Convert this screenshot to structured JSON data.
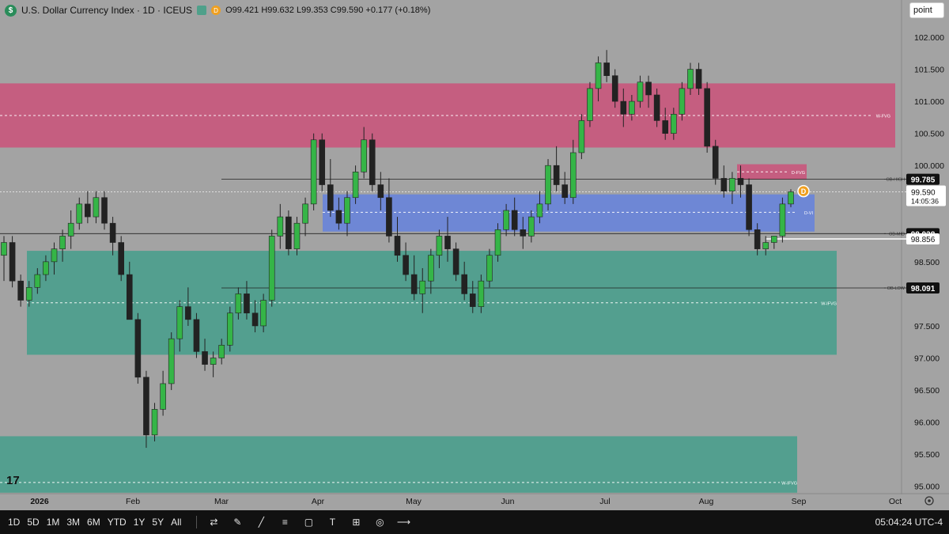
{
  "header": {
    "title": "U.S. Dollar Currency Index · 1D · ICEUS",
    "ohlc": "O99.421 H99.632 L99.353 C99.590 +0.177 (+0.18%)",
    "logo_glyph": "$",
    "badge_letter": "D"
  },
  "point_button": {
    "label": "point"
  },
  "chart_data": {
    "type": "candlestick",
    "ylim": [
      94.85,
      102.4
    ],
    "x_tick_labels": [
      "2026",
      "Feb",
      "Mar",
      "Apr",
      "May",
      "Jun",
      "Jul",
      "Aug",
      "Sep",
      "Oct"
    ],
    "y_ticks": [
      "102.000",
      "101.500",
      "101.000",
      "100.500",
      "100.000",
      "98.500",
      "97.500",
      "97.000",
      "96.500",
      "96.000",
      "95.500",
      "95.000"
    ],
    "zones": [
      {
        "label": "W-FVG",
        "low": 100.28,
        "high": 101.28,
        "mid": 100.78,
        "color": "#c75b7e"
      },
      {
        "label": "D-FVG",
        "low": 99.78,
        "high": 100.02,
        "mid": 99.9,
        "color": "#c75b7e"
      },
      {
        "label": "D-VI",
        "low": 98.97,
        "high": 99.55,
        "mid": 99.27,
        "color": "#6b86d8"
      },
      {
        "label": "W-IFVG",
        "low": 97.05,
        "high": 98.67,
        "mid": 97.86,
        "color": "#4f9f8e"
      },
      {
        "label": "W-IFVG",
        "low": 94.9,
        "high": 95.78,
        "mid": 95.06,
        "color": "#4f9f8e"
      }
    ],
    "levels": [
      {
        "label": "OB-HIGH",
        "value": 99.785,
        "price_text": "99.785"
      },
      {
        "label": "OB-MID",
        "value": 98.938,
        "price_text": "98.938"
      },
      {
        "label": "OB-LOW",
        "value": 98.091,
        "price_text": "98.091"
      }
    ],
    "white_level": {
      "value": 98.856,
      "price_text": "98.856"
    },
    "current": {
      "value": 99.59,
      "price_text": "99.590",
      "countdown": "14:05:36"
    },
    "candles_ohlc": [
      [
        98.6,
        98.9,
        98.2,
        98.8
      ],
      [
        98.8,
        98.9,
        98.1,
        98.2
      ],
      [
        98.2,
        98.3,
        97.8,
        97.9
      ],
      [
        97.9,
        98.2,
        97.8,
        98.1
      ],
      [
        98.1,
        98.4,
        98.0,
        98.3
      ],
      [
        98.3,
        98.6,
        98.2,
        98.5
      ],
      [
        98.5,
        98.8,
        98.3,
        98.7
      ],
      [
        98.7,
        99.0,
        98.5,
        98.9
      ],
      [
        98.9,
        99.3,
        98.7,
        99.1
      ],
      [
        99.1,
        99.5,
        99.0,
        99.4
      ],
      [
        99.4,
        99.6,
        99.1,
        99.2
      ],
      [
        99.2,
        99.6,
        99.1,
        99.5
      ],
      [
        99.5,
        99.6,
        99.0,
        99.1
      ],
      [
        99.1,
        99.2,
        98.6,
        98.8
      ],
      [
        98.8,
        98.9,
        98.2,
        98.3
      ],
      [
        98.3,
        98.5,
        97.6,
        97.6
      ],
      [
        97.6,
        97.7,
        96.6,
        96.7
      ],
      [
        96.7,
        96.8,
        95.6,
        95.8
      ],
      [
        95.8,
        96.3,
        95.7,
        96.2
      ],
      [
        96.2,
        96.8,
        96.1,
        96.6
      ],
      [
        96.6,
        97.4,
        96.5,
        97.3
      ],
      [
        97.3,
        97.9,
        97.1,
        97.8
      ],
      [
        97.8,
        98.1,
        97.5,
        97.6
      ],
      [
        97.6,
        97.7,
        97.0,
        97.1
      ],
      [
        97.1,
        97.3,
        96.8,
        96.9
      ],
      [
        96.9,
        97.1,
        96.7,
        97.0
      ],
      [
        97.0,
        97.3,
        96.9,
        97.2
      ],
      [
        97.2,
        97.8,
        97.1,
        97.7
      ],
      [
        97.7,
        98.1,
        97.6,
        98.0
      ],
      [
        98.0,
        98.2,
        97.6,
        97.7
      ],
      [
        97.7,
        97.9,
        97.4,
        97.5
      ],
      [
        97.5,
        98.0,
        97.4,
        97.9
      ],
      [
        97.9,
        99.0,
        97.8,
        98.9
      ],
      [
        98.9,
        99.4,
        98.7,
        99.2
      ],
      [
        99.2,
        99.3,
        98.6,
        98.7
      ],
      [
        98.7,
        99.2,
        98.6,
        99.1
      ],
      [
        99.1,
        99.5,
        98.9,
        99.4
      ],
      [
        99.4,
        100.5,
        99.3,
        100.4
      ],
      [
        100.4,
        100.5,
        99.6,
        99.7
      ],
      [
        99.7,
        100.1,
        99.2,
        99.3
      ],
      [
        99.3,
        99.5,
        99.0,
        99.1
      ],
      [
        99.1,
        99.6,
        98.9,
        99.5
      ],
      [
        99.5,
        100.0,
        99.4,
        99.9
      ],
      [
        99.9,
        100.6,
        99.8,
        100.4
      ],
      [
        100.4,
        100.5,
        99.6,
        99.7
      ],
      [
        99.7,
        99.9,
        99.3,
        99.5
      ],
      [
        99.5,
        99.8,
        98.8,
        98.9
      ],
      [
        98.9,
        99.2,
        98.5,
        98.6
      ],
      [
        98.6,
        98.8,
        98.2,
        98.3
      ],
      [
        98.3,
        98.6,
        97.9,
        98.0
      ],
      [
        98.0,
        98.4,
        97.7,
        98.2
      ],
      [
        98.2,
        98.7,
        98.0,
        98.6
      ],
      [
        98.6,
        99.0,
        98.4,
        98.9
      ],
      [
        98.9,
        99.2,
        98.5,
        98.7
      ],
      [
        98.7,
        98.8,
        98.2,
        98.3
      ],
      [
        98.3,
        98.5,
        97.9,
        98.0
      ],
      [
        98.0,
        98.2,
        97.7,
        97.8
      ],
      [
        97.8,
        98.3,
        97.7,
        98.2
      ],
      [
        98.2,
        98.7,
        98.1,
        98.6
      ],
      [
        98.6,
        99.1,
        98.5,
        99.0
      ],
      [
        99.0,
        99.4,
        98.9,
        99.3
      ],
      [
        99.3,
        99.5,
        98.9,
        99.0
      ],
      [
        99.0,
        99.2,
        98.7,
        98.9
      ],
      [
        98.9,
        99.3,
        98.8,
        99.2
      ],
      [
        99.2,
        99.6,
        99.1,
        99.4
      ],
      [
        99.4,
        100.1,
        99.3,
        100.0
      ],
      [
        100.0,
        100.3,
        99.6,
        99.7
      ],
      [
        99.7,
        99.9,
        99.4,
        99.5
      ],
      [
        99.5,
        100.4,
        99.4,
        100.2
      ],
      [
        100.2,
        100.8,
        100.1,
        100.7
      ],
      [
        100.7,
        101.3,
        100.6,
        101.2
      ],
      [
        101.2,
        101.7,
        101.0,
        101.6
      ],
      [
        101.6,
        101.8,
        101.3,
        101.4
      ],
      [
        101.4,
        101.5,
        100.9,
        101.0
      ],
      [
        101.0,
        101.2,
        100.6,
        100.8
      ],
      [
        100.8,
        101.1,
        100.7,
        101.0
      ],
      [
        101.0,
        101.4,
        100.9,
        101.3
      ],
      [
        101.3,
        101.4,
        100.9,
        101.1
      ],
      [
        101.1,
        101.2,
        100.6,
        100.7
      ],
      [
        100.7,
        100.9,
        100.4,
        100.5
      ],
      [
        100.5,
        100.9,
        100.4,
        100.8
      ],
      [
        100.8,
        101.3,
        100.7,
        101.2
      ],
      [
        101.2,
        101.6,
        101.1,
        101.5
      ],
      [
        101.5,
        101.6,
        101.1,
        101.2
      ],
      [
        101.2,
        101.3,
        100.2,
        100.3
      ],
      [
        100.3,
        100.4,
        99.7,
        99.8
      ],
      [
        99.8,
        100.0,
        99.5,
        99.6
      ],
      [
        99.6,
        99.9,
        99.4,
        99.8
      ],
      [
        99.8,
        100.0,
        99.5,
        99.7
      ],
      [
        99.7,
        99.8,
        98.9,
        99.0
      ],
      [
        99.0,
        99.1,
        98.6,
        98.7
      ],
      [
        98.7,
        98.9,
        98.6,
        98.8
      ],
      [
        98.8,
        98.9,
        98.7,
        98.9
      ],
      [
        98.9,
        99.5,
        98.8,
        99.4
      ],
      [
        99.4,
        99.63,
        99.35,
        99.59
      ]
    ]
  },
  "bottom_bar": {
    "ranges": [
      "1D",
      "5D",
      "1M",
      "3M",
      "6M",
      "YTD",
      "1Y",
      "5Y",
      "All"
    ],
    "tools": [
      {
        "name": "compare-icon",
        "glyph": "⇄"
      },
      {
        "name": "brush-icon",
        "glyph": "✎"
      },
      {
        "name": "trend-line-icon",
        "glyph": "╱"
      },
      {
        "name": "fib-icon",
        "glyph": "≡"
      },
      {
        "name": "rectangle-icon",
        "glyph": "▢"
      },
      {
        "name": "text-icon",
        "glyph": "T"
      },
      {
        "name": "measure-icon",
        "glyph": "⊞"
      },
      {
        "name": "target-icon",
        "glyph": "◎"
      },
      {
        "name": "arrow-line-icon",
        "glyph": "⟶"
      }
    ],
    "clock": "05:04:24 UTC-4"
  },
  "tv_logo": "17",
  "colors": {
    "up": "#35b547",
    "down": "#222222",
    "axis_text": "#111111"
  }
}
